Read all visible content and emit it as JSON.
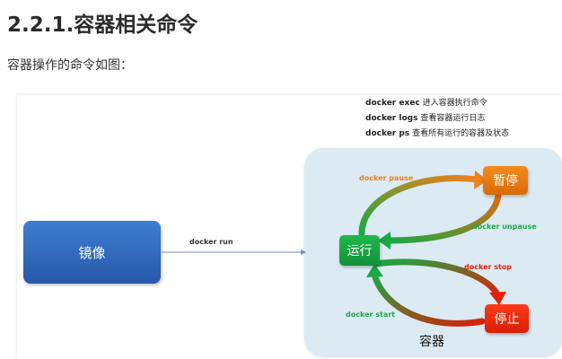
{
  "heading": "2.2.1.容器相关命令",
  "intro": "容器操作的命令如图：",
  "figure": {
    "commands": [
      {
        "cmd": "docker exec",
        "desc": "进入容器执行命令"
      },
      {
        "cmd": "docker logs",
        "desc": "查看容器运行日志"
      },
      {
        "cmd": "docker ps",
        "desc": "查看所有运行的容器及状态"
      }
    ],
    "image_label": "镜像",
    "run_label": "docker run",
    "container_label": "容器",
    "states": {
      "running": "运行",
      "paused": "暂停",
      "stopped": "停止"
    },
    "transitions": {
      "pause": "docker pause",
      "unpause": "docker unpause",
      "stop": "docker stop",
      "start": "docker start"
    },
    "colors": {
      "pause": "#e8801b",
      "unpause": "#22a848",
      "stop": "#e8200a",
      "start": "#22a848",
      "container_bg": "#dbeaf3",
      "image_box": "#3469bd"
    }
  }
}
